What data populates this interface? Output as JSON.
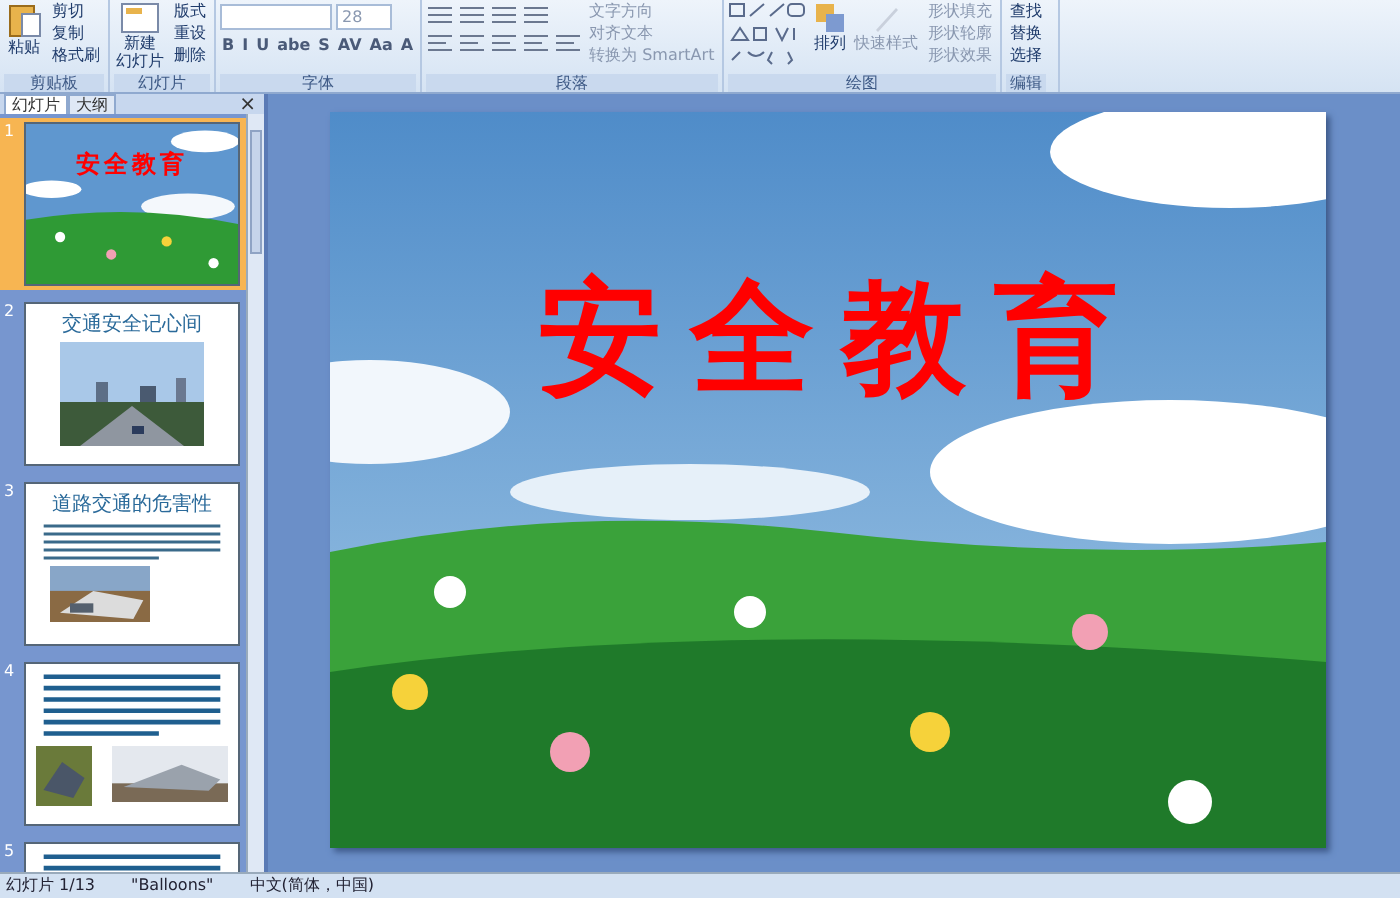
{
  "ribbon": {
    "groups": [
      {
        "label": "剪贴板",
        "kind": "clipboard",
        "large": [
          "粘贴"
        ],
        "items": [
          "剪切",
          "复制",
          "格式刷"
        ]
      },
      {
        "label": "幻灯片",
        "kind": "slides",
        "large": [
          "新建",
          "幻灯片"
        ],
        "items": [
          "版式",
          "重设",
          "删除"
        ]
      },
      {
        "label": "字体",
        "kind": "font",
        "font_size": "28",
        "buttons": [
          "B",
          "I",
          "U",
          "abe",
          "S",
          "AV",
          "Aa",
          "A"
        ]
      },
      {
        "label": "段落",
        "kind": "paragraph",
        "items": [
          "文字方向",
          "对齐文本",
          "转换为 SmartArt"
        ]
      },
      {
        "label": "绘图",
        "kind": "drawing",
        "large": "排列",
        "quick": "快速样式",
        "items": [
          "形状填充",
          "形状轮廓",
          "形状效果"
        ]
      },
      {
        "label": "编辑",
        "kind": "editing",
        "items": [
          "查找",
          "替换",
          "选择"
        ]
      }
    ]
  },
  "panel": {
    "tabs": [
      {
        "label": "幻灯片",
        "selected": true
      },
      {
        "label": "大纲",
        "selected": false
      }
    ],
    "close": "×",
    "slides": [
      {
        "number": "1",
        "selected": true,
        "kind": "title",
        "title": "安全教育"
      },
      {
        "number": "2",
        "selected": false,
        "title": "交通安全记心间"
      },
      {
        "number": "3",
        "selected": false,
        "kind": "text_photo",
        "title": "道路交通的危害性"
      },
      {
        "number": "4",
        "selected": false,
        "kind": "text_two_photos"
      },
      {
        "number": "5",
        "selected": false,
        "kind": "text"
      }
    ]
  },
  "slide": {
    "title": "安全教育"
  },
  "status_bar": [
    "幻灯片 1/13",
    "\"Balloons\"",
    "中文(简体，中国)"
  ]
}
